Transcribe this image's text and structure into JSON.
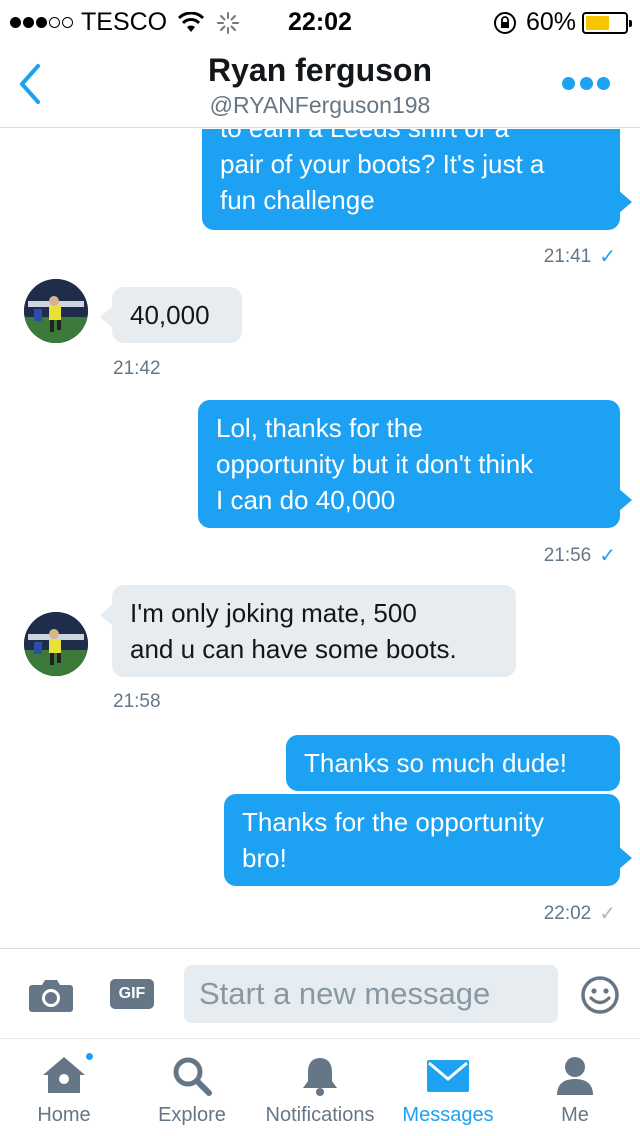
{
  "status_bar": {
    "carrier": "TESCO",
    "time": "22:02",
    "battery": "60%",
    "battery_level": 0.6,
    "signal_bars": 3,
    "signal_total": 5
  },
  "header": {
    "name": "Ryan ferguson",
    "handle": "@RYANFerguson198"
  },
  "messages": [
    {
      "direction": "out",
      "lines": [
        "to earn a Leeds shirt or a",
        "pair of your boots? It's just a",
        "fun challenge"
      ],
      "time": "21:41",
      "status": "read"
    },
    {
      "direction": "in",
      "lines": [
        "40,000"
      ],
      "time": "21:42"
    },
    {
      "direction": "out",
      "lines": [
        "Lol, thanks for the",
        "opportunity but it don't think",
        "I can do 40,000"
      ],
      "time": "21:56",
      "status": "read"
    },
    {
      "direction": "in",
      "lines": [
        "I'm only joking mate, 500",
        "and u can have some boots."
      ],
      "time": "21:58"
    },
    {
      "direction": "out",
      "lines": [
        "Thanks so much dude!"
      ]
    },
    {
      "direction": "out",
      "lines": [
        "Thanks for the opportunity",
        "bro!"
      ],
      "time": "22:02",
      "status": "sent"
    }
  ],
  "composer": {
    "gif_label": "GIF",
    "placeholder": "Start a new message"
  },
  "tabs": [
    {
      "label": "Home",
      "icon": "home-icon",
      "badge": true
    },
    {
      "label": "Explore",
      "icon": "search-icon"
    },
    {
      "label": "Notifications",
      "icon": "bell-icon"
    },
    {
      "label": "Messages",
      "icon": "envelope-icon",
      "active": true
    },
    {
      "label": "Me",
      "icon": "person-icon"
    }
  ],
  "colors": {
    "accent": "#1da1f2",
    "incoming_bubble": "#e6ecf0",
    "secondary_text": "#657786",
    "battery": "#f7c600"
  }
}
